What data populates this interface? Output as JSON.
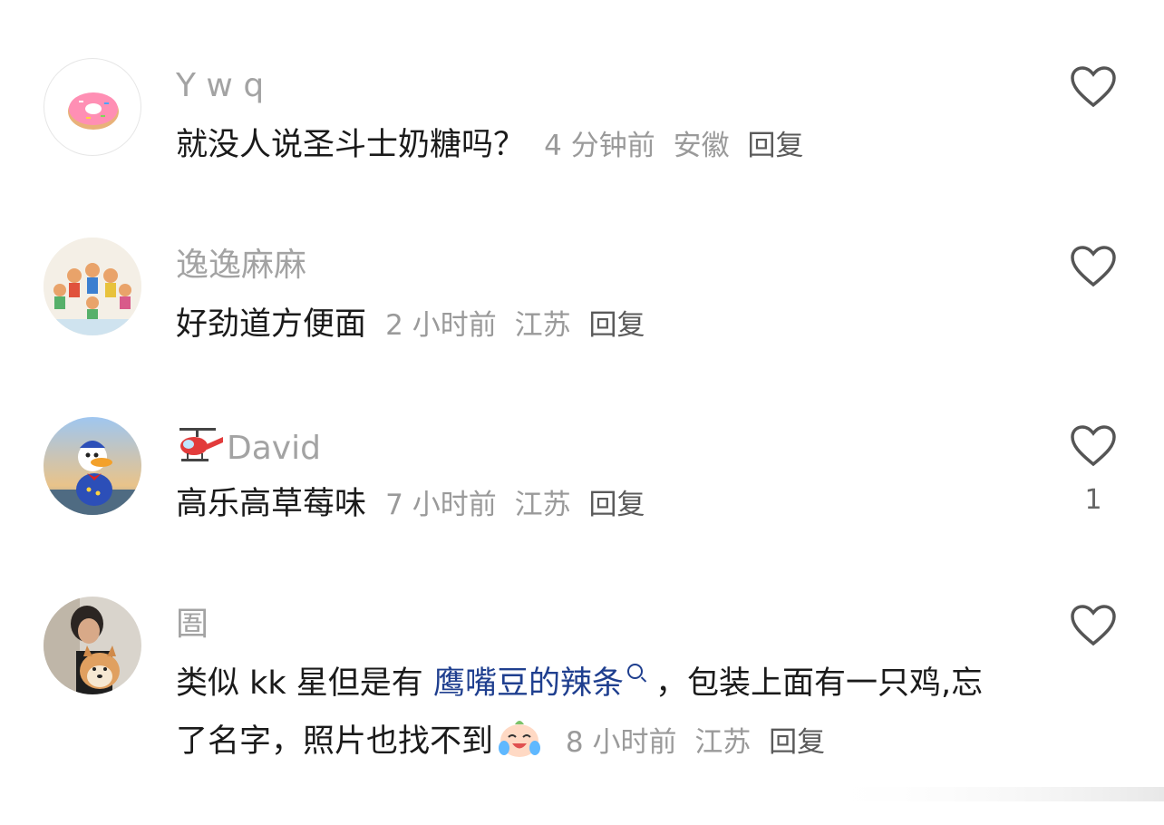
{
  "comments": [
    {
      "username": "Y w q",
      "text": "就没人说圣斗士奶糖吗？",
      "time": "4 分钟前",
      "location": "安徽",
      "reply": "回复",
      "avatar": "donut-icon"
    },
    {
      "username": "逸逸麻麻",
      "text": "好劲道方便面",
      "time": "2 小时前",
      "location": "江苏",
      "reply": "回复",
      "avatar": "cartoon-kids-photo"
    },
    {
      "username": "David",
      "username_badge": "helicopter-emoji",
      "text": "高乐高草莓味",
      "time": "7 小时前",
      "location": "江苏",
      "reply": "回复",
      "likes": "1",
      "avatar": "donald-duck-photo"
    },
    {
      "username": "圄",
      "text_before_link": "类似 kk 星但是有",
      "link_text": "鹰嘴豆的辣条",
      "text_after_link": "，包装上面有一只鸡,忘了名字，照片也找不到",
      "emoji": "crying-laughing-emoji",
      "time": "8 小时前",
      "location": "江苏",
      "reply": "回复",
      "avatar": "person-with-shiba-photo"
    }
  ],
  "colors": {
    "username": "#a3a3a3",
    "text": "#1a1a1a",
    "meta": "#9a9a9a",
    "link": "#1f3f8f",
    "heart": "#555555"
  }
}
